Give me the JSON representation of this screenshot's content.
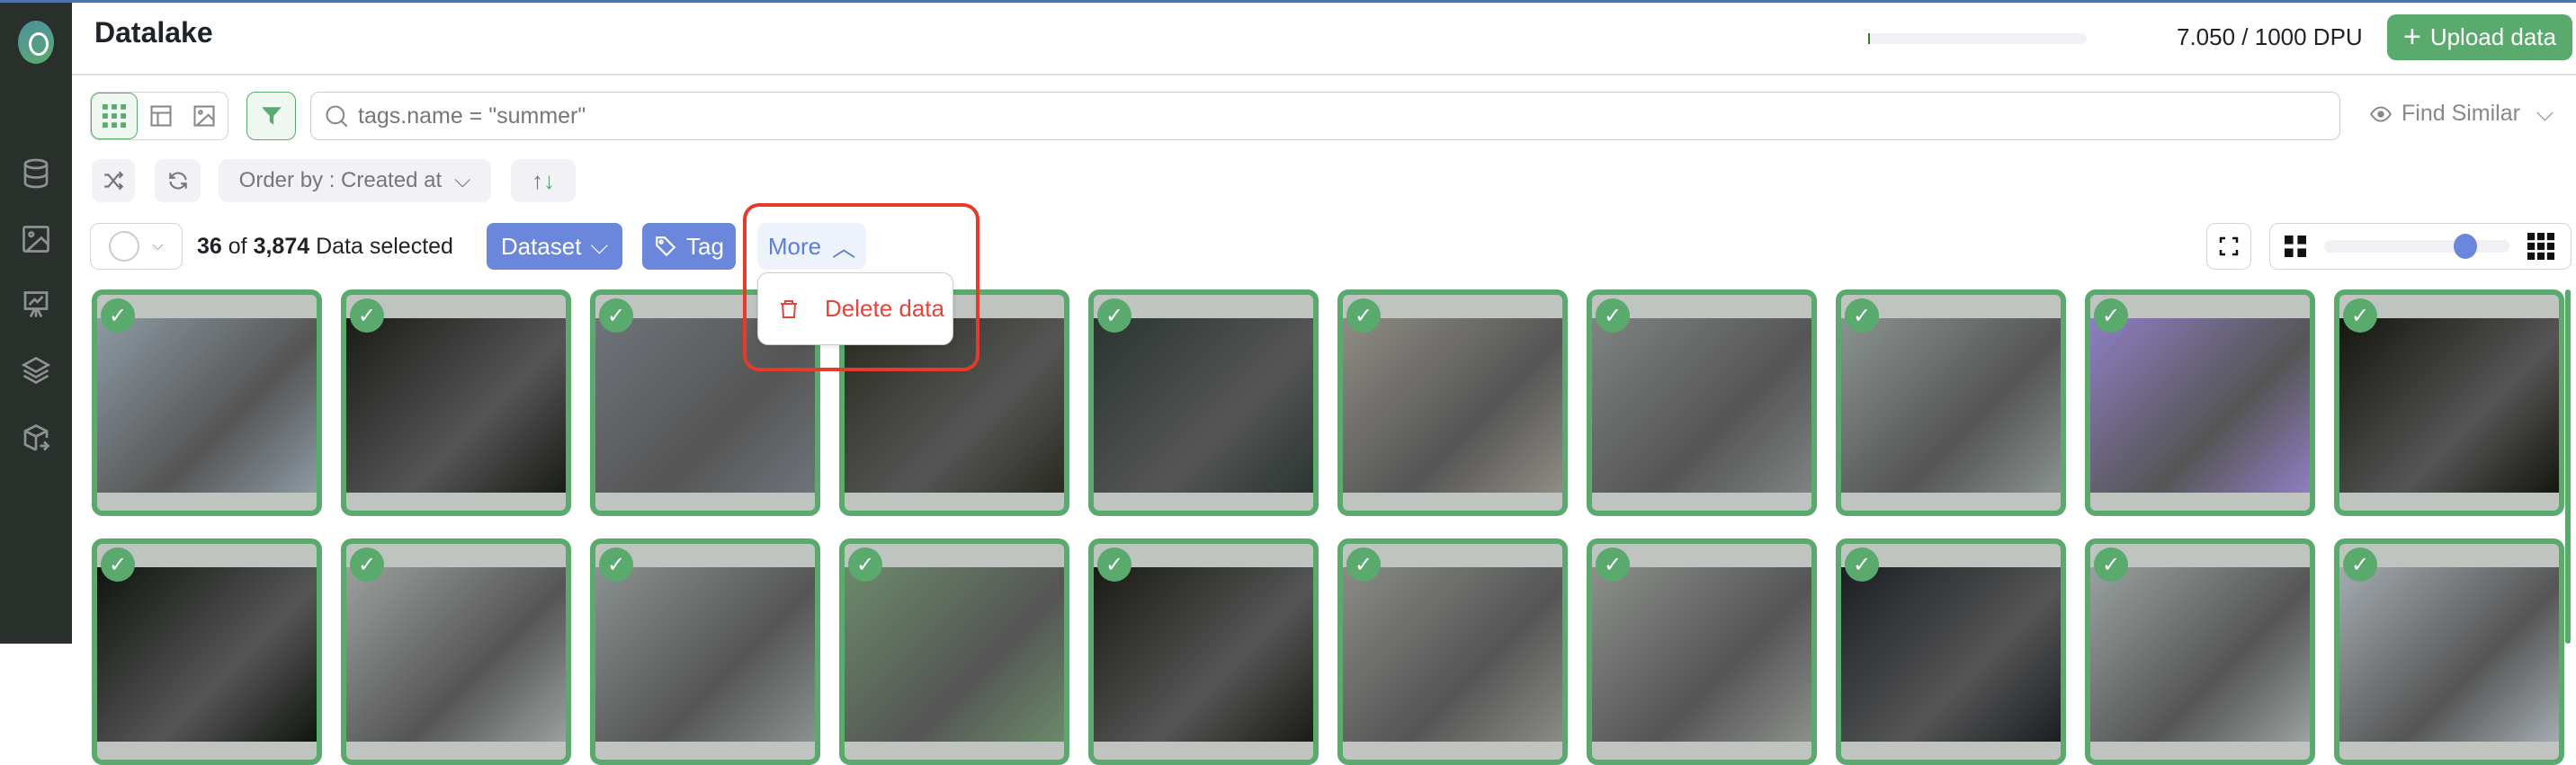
{
  "header": {
    "title": "Datalake",
    "dpu_text": "7.050 / 1000 DPU",
    "dpu_used_fraction": 0.00705,
    "upload_label": "Upload data"
  },
  "toolbar": {
    "search_value": "tags.name = \"summer\"",
    "find_similar_label": "Find Similar",
    "order_by_label": "Order by : Created at"
  },
  "selection": {
    "selected": "36",
    "of": "of",
    "total": "3,874",
    "suffix": "Data selected",
    "dataset_label": "Dataset",
    "tag_label": "Tag",
    "more_label": "More"
  },
  "more_menu": {
    "items": [
      {
        "label": "Delete data",
        "icon": "trash-icon"
      }
    ]
  },
  "zoom_slider": {
    "value_fraction": 0.76
  },
  "sidebar": {
    "items": [
      "database-icon",
      "image-icon",
      "presentation-chart-icon",
      "layers-icon",
      "box-export-icon"
    ]
  },
  "colors": {
    "accent_green": "#5aaa6e",
    "accent_blue": "#6b87db",
    "danger": "#e5443a",
    "sidebar": "#29302c"
  },
  "grid": {
    "rows": [
      [
        "#8d9aa3",
        "#1a1c18",
        "#6f747a",
        "#2a2a22",
        "#2b3530",
        "#8f8c84",
        "#7f8382",
        "#8a9290",
        "#8f7ec4",
        "#14160f"
      ],
      [
        "#111511",
        "#9aa09e",
        "#8a9190",
        "#6b8a6a",
        "#1a1a16",
        "#8a8a86",
        "#8c8f8c",
        "#1b1e22",
        "#9aa1a0",
        "#a4abb0"
      ]
    ]
  }
}
